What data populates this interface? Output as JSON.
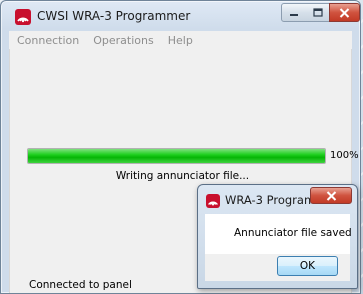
{
  "window": {
    "title": "CWSI WRA-3 Programmer",
    "icon": "app-logo-icon"
  },
  "menu": {
    "items": [
      "Connection",
      "Operations",
      "Help"
    ]
  },
  "progress": {
    "value_percent": 100,
    "percent_text": "100%",
    "label": "Writing annunciator file...",
    "fill_color": "#06b506"
  },
  "status": {
    "text": "Connected to panel"
  },
  "dialog": {
    "title": "WRA-3 Program...",
    "message": "Annunciator file saved",
    "ok_label": "OK"
  },
  "colors": {
    "close_button": "#c23a26",
    "brand_red": "#c8102e"
  }
}
